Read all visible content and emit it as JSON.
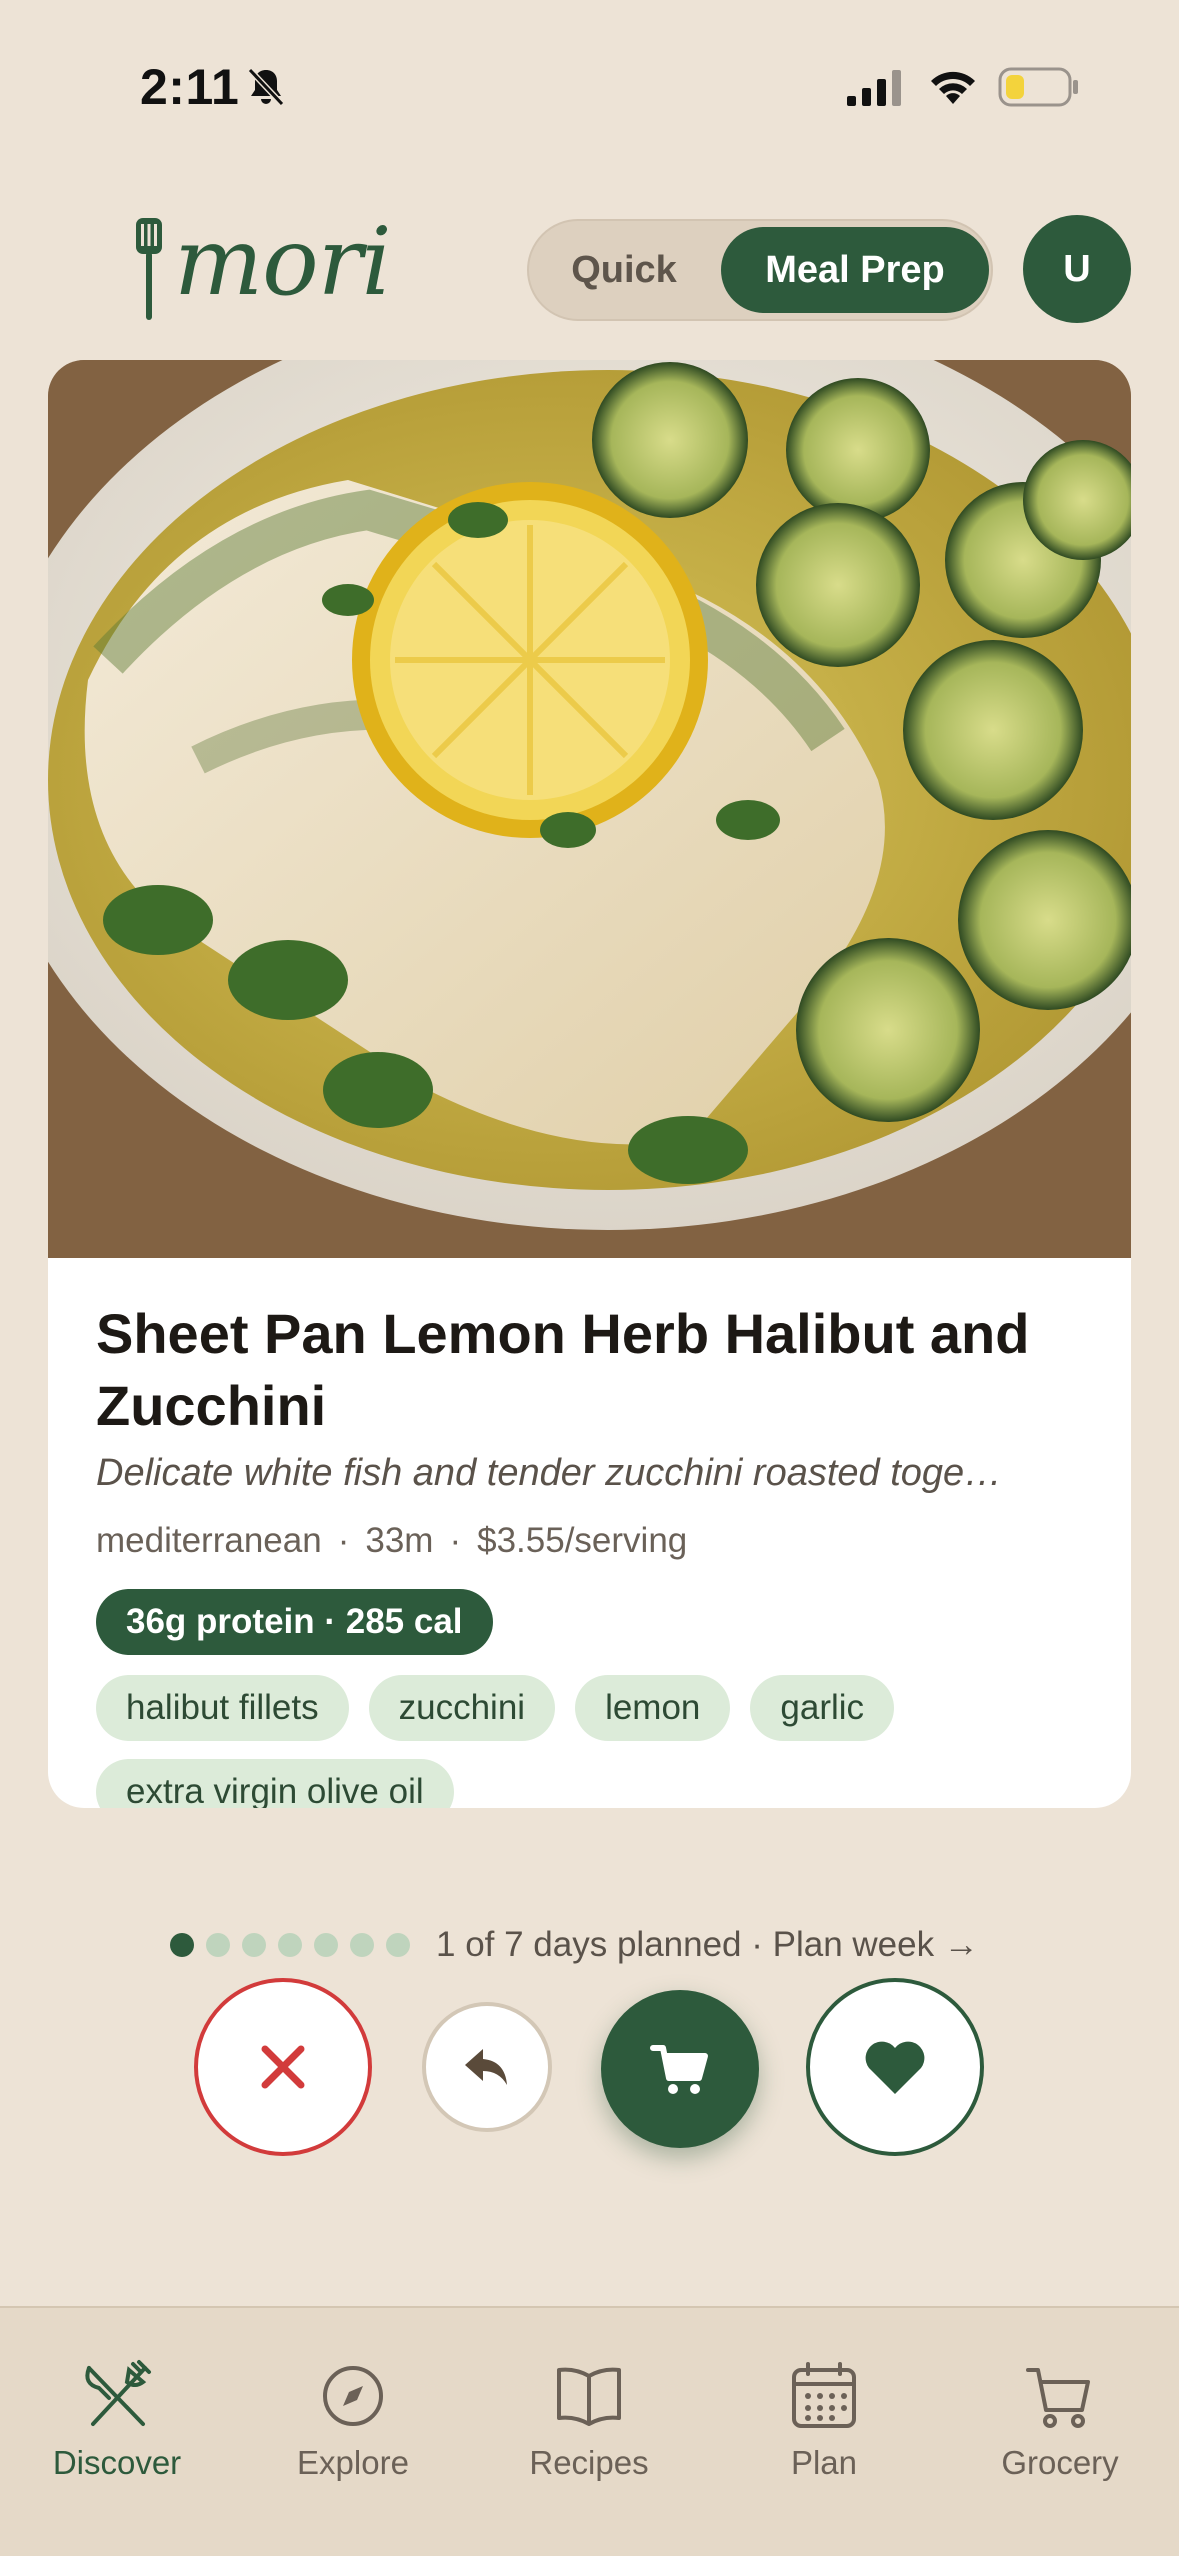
{
  "status_bar": {
    "time": "2:11"
  },
  "header": {
    "logo_text": "mori",
    "modes": {
      "quick": "Quick",
      "meal_prep": "Meal Prep",
      "selected": "Meal Prep"
    },
    "avatar_initial": "U"
  },
  "recipe": {
    "title": "Sheet Pan Lemon Herb Halibut and Zucchini",
    "description": "Delicate white fish and tender zucchini roasted toge…",
    "cuisine": "mediterranean",
    "time": "33m",
    "cost": "$3.55/serving",
    "meta_separator": "·",
    "nutrition": "36g protein · 285 cal",
    "ingredients": [
      "halibut fillets",
      "zucchini",
      "lemon",
      "garlic",
      "extra virgin olive oil"
    ]
  },
  "plan_progress": {
    "planned": 1,
    "total": 7,
    "text": "1 of 7 days planned · Plan week →"
  },
  "actions": [
    "close-icon",
    "undo-icon",
    "cart-icon",
    "heart-icon"
  ],
  "nav": {
    "items": [
      {
        "label": "Discover",
        "icon": "utensils-icon",
        "active": true
      },
      {
        "label": "Explore",
        "icon": "compass-icon",
        "active": false
      },
      {
        "label": "Recipes",
        "icon": "book-icon",
        "active": false
      },
      {
        "label": "Plan",
        "icon": "calendar-icon",
        "active": false
      },
      {
        "label": "Grocery",
        "icon": "cart-icon",
        "active": false
      }
    ]
  },
  "colors": {
    "background": "#ede3d6",
    "accent": "#2d5a3c",
    "tag_bg": "#dcebd9",
    "skip_red": "#d23b3b",
    "battery_yellow": "#f3d33c"
  }
}
